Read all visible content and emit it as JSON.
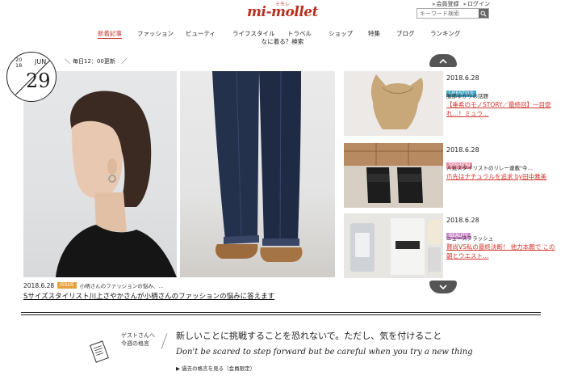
{
  "header": {
    "logo_ruby": "ミモレ",
    "logo_text": "mi-mollet",
    "util_links": [
      "会員登録",
      "ログイン"
    ],
    "search_placeholder": "キーワード検索"
  },
  "gnav": {
    "items": [
      "新着記事",
      "ファッション",
      "ビューティ",
      "ライフスタイル",
      "トラベル",
      "ショップ",
      "特集",
      "ブログ",
      "ランキング"
    ],
    "active_index": 0,
    "sub": "なに着る？検索"
  },
  "date_badge": {
    "year": "20\n18",
    "month": "JUN",
    "day": "29"
  },
  "update_text": "毎日12：00更新",
  "feature": {
    "date": "2018.6.28",
    "badge": "ISSUE",
    "sub": "小柄さんのファッションの悩み、…",
    "title": "Sサイズスタイリスト川上さやかさんが小柄さんのファッションの悩みに答えます"
  },
  "side_items": [
    {
      "date": "2018.6.28",
      "category": "LIFESTYLE",
      "sub": "服部ゆかりの話題",
      "title": "【垂希のモノSTORY／最終回】一目惚れ…！ミュラ…"
    },
    {
      "date": "2018.6.28",
      "category": "FASHION",
      "sub": "人気スタイリストのリレー連載\"今…",
      "title": "爪先はナチュラルを追求 by田中雅美"
    },
    {
      "date": "2018.6.28",
      "category": "BEAUTY",
      "sub": "ニュースフラッシュ",
      "title": "賢尚VS私の最終決断！ 他力本願で この朝とウエスト…"
    }
  ],
  "guest": {
    "label_line1": "ゲストさんへ",
    "label_line2": "今週の格言",
    "quote_jp": "新しいことに挑戦することを恐れないで。ただし、気を付けること",
    "quote_en": "Don't be scared to step forward but be careful when you try a new thing",
    "link": "過去の格言を見る（会員限定）"
  },
  "colors": {
    "accent": "#d0342c",
    "lifestyle": "#3fa7c7",
    "fashion": "#e88ba0",
    "beauty": "#c888c6",
    "issue": "#e6a03c"
  }
}
